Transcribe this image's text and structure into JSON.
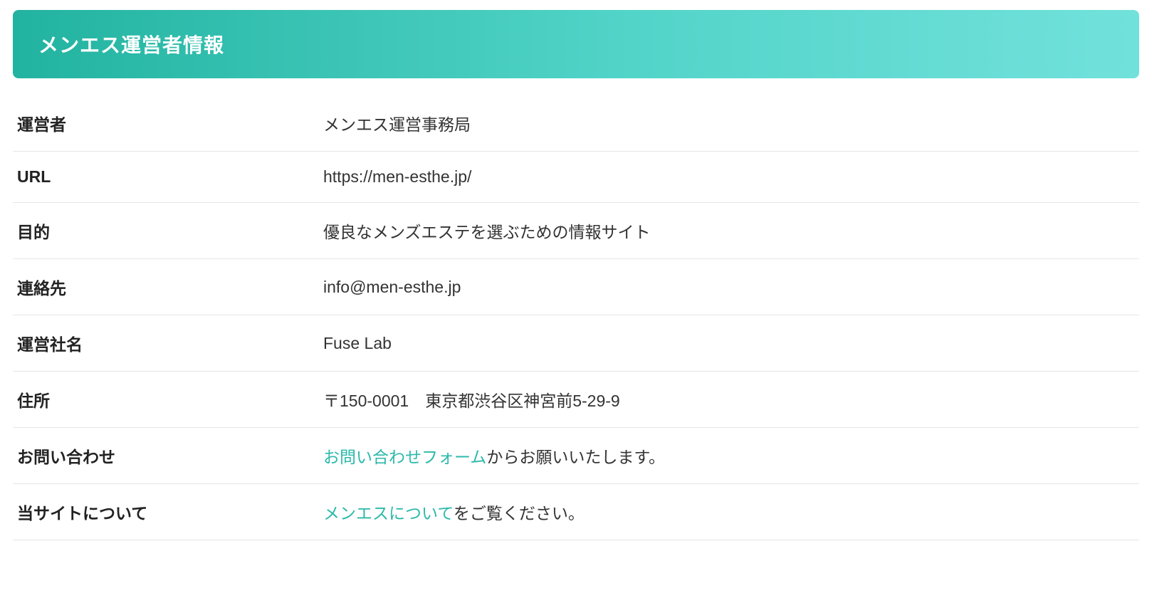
{
  "header": {
    "title": "メンエス運営者情報"
  },
  "colors": {
    "accent": "#2cb9aa"
  },
  "rows": [
    {
      "label": "運営者",
      "value": "メンエス運営事務局"
    },
    {
      "label": "URL",
      "value": "https://men-esthe.jp/"
    },
    {
      "label": "目的",
      "value": "優良なメンズエステを選ぶための情報サイト"
    },
    {
      "label": "連絡先",
      "value": "info@men-esthe.jp"
    },
    {
      "label": "運営社名",
      "value": "Fuse Lab"
    },
    {
      "label": "住所",
      "value": "〒150-0001　東京都渋谷区神宮前5-29-9"
    },
    {
      "label": "お問い合わせ",
      "link_text": "お問い合わせフォーム",
      "suffix": "からお願いいたします。"
    },
    {
      "label": "当サイトについて",
      "link_text": "メンエスについて",
      "suffix": "をご覧ください。"
    }
  ]
}
